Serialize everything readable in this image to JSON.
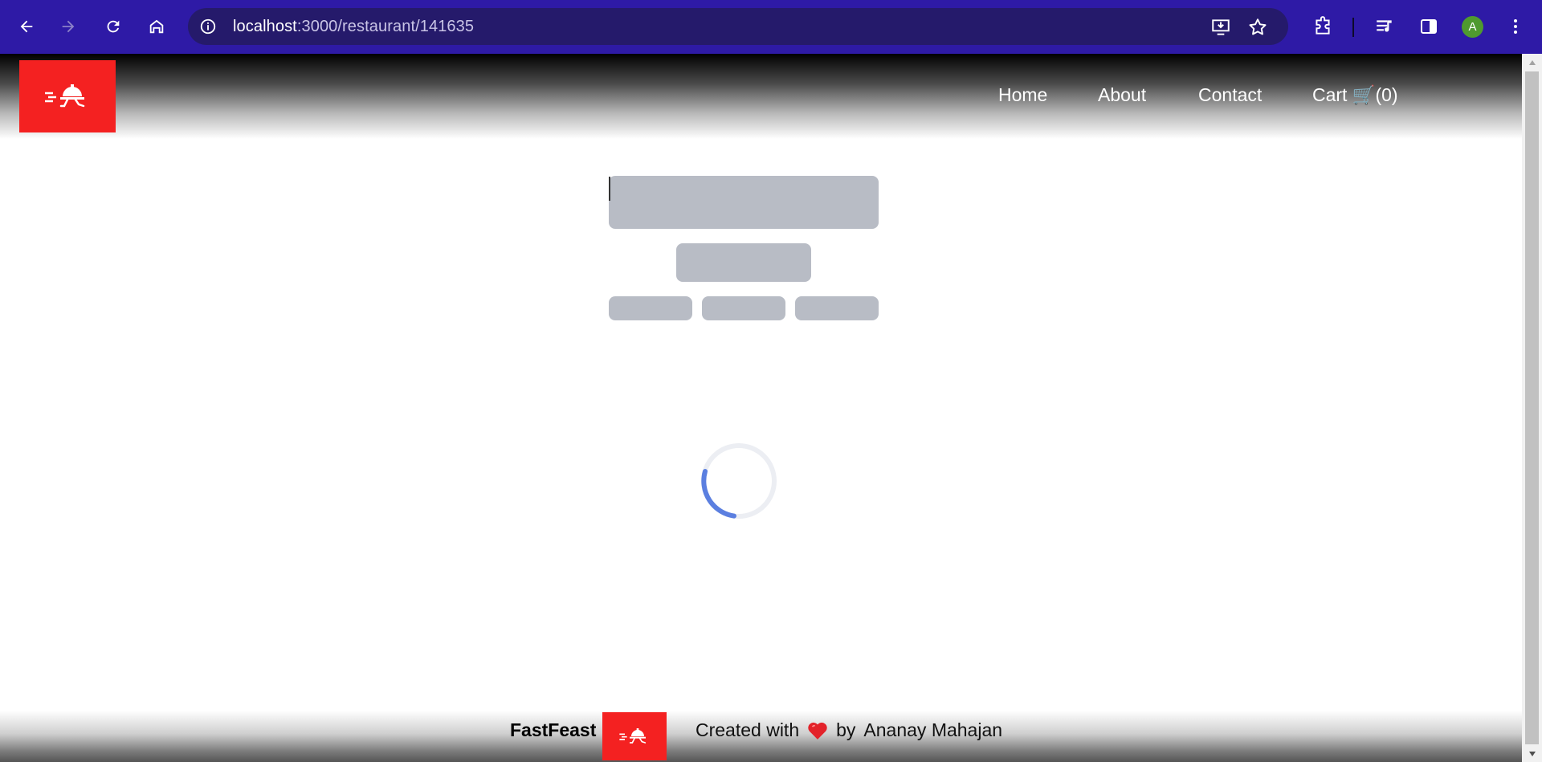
{
  "browser": {
    "url_host": "localhost",
    "url_path": ":3000/restaurant/141635",
    "profile_initial": "A",
    "icons": [
      "back-arrow-icon",
      "forward-arrow-icon",
      "reload-icon",
      "home-icon",
      "site-info-icon",
      "install-app-icon",
      "bookmark-star-icon",
      "extensions-puzzle-icon",
      "media-queue-icon",
      "side-panel-icon",
      "more-menu-icon"
    ]
  },
  "header": {
    "logo_icon": "food-delivery-bell-icon",
    "nav": {
      "home": "Home",
      "about": "About",
      "contact": "Contact",
      "cart": "Cart 🛒(0)"
    }
  },
  "loading": {
    "spinner_icon": "loading-spinner-icon"
  },
  "footer": {
    "brand": "FastFeast",
    "created_with": "Created with",
    "heart_icon": "heart-icon",
    "by": "by",
    "author": "Ananay Mahajan"
  },
  "colors": {
    "browser_chrome": "#2e1aa6",
    "omnibox": "#251a6b",
    "brand_red": "#f42121",
    "shimmer": "#b8bcc5",
    "spinner_accent": "#5b7fe0"
  }
}
